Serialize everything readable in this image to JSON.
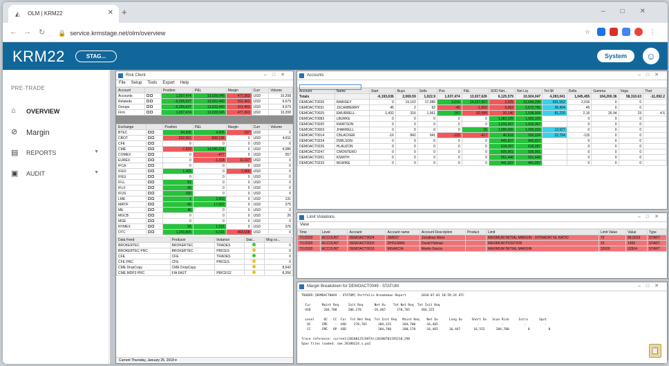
{
  "browser": {
    "tab_title": "OLM | KRM22",
    "url": "service.krmstage.net/olm/overview"
  },
  "app": {
    "logo": "KRM22",
    "env": "STAG...",
    "system_btn": "System"
  },
  "sidebar": {
    "section": "PRE-TRADE",
    "items": [
      {
        "label": "OVERVIEW",
        "icon": "home-icon"
      },
      {
        "label": "Margin",
        "icon": "margin-icon"
      },
      {
        "label": "REPORTS",
        "icon": "reports-icon"
      },
      {
        "label": "AUDIT",
        "icon": "audit-icon"
      }
    ]
  },
  "risk": {
    "title": "Risk Client",
    "menu": [
      "File",
      "Setup",
      "Tools",
      "Export",
      "Help"
    ],
    "t1_headers": [
      "Account",
      "",
      "Position",
      "P&L",
      "Margin",
      "Curr",
      "Volume"
    ],
    "t1_rows": [
      [
        "Accounts",
        "1,037,474",
        "13,028,045",
        "477,363",
        "USD",
        "10,208"
      ],
      [
        "Relateds",
        "-6,295,637",
        "13,033,449",
        "151,463",
        "USD",
        "9,679"
      ],
      [
        "Groups",
        "-6,295,637",
        "13,033,449",
        "151,463",
        "USD",
        "9,679"
      ],
      [
        "Firm",
        "1,037,474",
        "13,028,045",
        "477,363",
        "USD",
        "10,208"
      ]
    ],
    "t2_headers": [
      "Exchange",
      "",
      "Position",
      "P&L",
      "Margin",
      "Curr",
      "Volume"
    ],
    "t2_rows": [
      [
        "BTEC",
        "64,935",
        "4,505",
        "337",
        "USD",
        "0"
      ],
      [
        "CBOT",
        "-232,051",
        "-939,136",
        "0",
        "USD",
        "4,811"
      ],
      [
        "CFE",
        "0",
        "0",
        "0",
        "USD",
        "0"
      ],
      [
        "CME",
        "-7,929",
        "14,046,634",
        "0",
        "USD",
        "4,086"
      ],
      [
        "COMEX",
        "0",
        "-477",
        "0",
        "USD",
        "557"
      ],
      [
        "EUREX",
        "0",
        "-1,318",
        "11,117",
        "USD",
        "0"
      ],
      [
        "IFCA",
        "0",
        "0",
        "0",
        "USD",
        "0"
      ],
      [
        "IFEO",
        "1,405",
        "0",
        "1,466",
        "USD",
        "0"
      ],
      [
        "IFEU",
        "0",
        "0",
        "0",
        "USD",
        "0"
      ],
      [
        "IFLL",
        "81",
        "0",
        "0",
        "USD",
        "0"
      ],
      [
        "IFLX",
        "56",
        "0",
        "0",
        "USD",
        "0"
      ],
      [
        "IFUS",
        "100",
        "0",
        "0",
        "USD",
        "0"
      ],
      [
        "LME",
        "1",
        "3,960",
        "0",
        "USD",
        "131"
      ],
      [
        "MATIF",
        "66",
        "17,922",
        "0",
        "USD",
        "275"
      ],
      [
        "ME",
        "46",
        "0",
        "0",
        "USD",
        "0"
      ],
      [
        "MGCB",
        "0",
        "0",
        "0",
        "USD",
        "26"
      ],
      [
        "MGE",
        "0",
        "0",
        "0",
        "USD",
        "0"
      ],
      [
        "NYMEX",
        "56",
        "1,515",
        "0",
        "USD",
        "376"
      ],
      [
        "OTC",
        "1,243,805",
        "6,016",
        "464,508",
        "USD",
        "0"
      ]
    ],
    "t3_headers": [
      "Data Feed",
      "Producer",
      "Instance",
      "Stat...",
      "Msg co..."
    ],
    "t3_rows": [
      [
        "BROKERTEC",
        "BROKERTEC",
        "TRADES",
        "0"
      ],
      [
        "BROKERTEC PRC",
        "BROKERTEC",
        "PRICES",
        "0"
      ],
      [
        "CFE",
        "CFE",
        "TRADES",
        "0"
      ],
      [
        "CFE PRC",
        "CFE",
        "PRICES",
        "0"
      ],
      [
        "CME DropCopy",
        "CME DropCopy",
        "",
        "8,642"
      ],
      [
        "CME MDP3 PRC",
        "FIA FAST",
        "PRICES2",
        "8,356"
      ]
    ],
    "status": "Current Thursday, January 25, 2018"
  },
  "accounts": {
    "title": "Accounts",
    "headers": [
      "Account",
      "Name",
      "Start",
      "Buys",
      "Sells",
      "Pos",
      "P&L",
      "SOD Net...",
      "Net Liq",
      "Tot IM",
      "Delta",
      "Gamma",
      "Vega",
      "Thet"
    ],
    "totals": [
      "Totals",
      "",
      "-6,193,636",
      "2,069.59",
      "1,022.9",
      "1,037,474",
      "13,027,626",
      "6,125,579",
      "10,924,047",
      "4,283,041",
      "1,045,455",
      "104,200.36",
      "58,310.63",
      "-11,092.2"
    ],
    "rows": [
      [
        "DEMOACT0026",
        "RAINSEY",
        "0",
        "19,102",
        "17,086",
        "2,016",
        "14,237,067",
        "2,025",
        "12,649,200",
        "691,552",
        "2,016",
        "0",
        "0",
        ""
      ],
      [
        "DEMOACT0031",
        "JSCARBERRY",
        "45",
        "2",
        "92",
        "-45",
        "-1,652",
        "6,062",
        "2,672,765",
        "36,404",
        "45",
        "0",
        "0",
        ""
      ],
      [
        "DEMOACT0025",
        "EMURRELL",
        "1,432",
        "316",
        "1,561",
        "187",
        "-92,089",
        "20,140",
        "1,538,909",
        "81,225",
        "2,16",
        "26.94",
        "23",
        "4.5"
      ],
      [
        "DEMOACT0083",
        "LBURKE",
        "0",
        "0",
        "0",
        "0",
        "0",
        "1,083,325",
        "1,083,325",
        "",
        "0",
        "0",
        "0",
        ""
      ],
      [
        "DEMOACT0020",
        "KWATSON",
        "0",
        "0",
        "0",
        "0",
        "0",
        "1,016,367",
        "1,016,367",
        "",
        "0",
        "0",
        "0",
        ""
      ],
      [
        "DEMOACT0003",
        "JHARRELL",
        "0",
        "0",
        "0",
        "0",
        "15",
        "1,000,006",
        "1,000,015",
        "12,927",
        "0",
        "0",
        "0",
        ""
      ],
      [
        "DEMOACT0014",
        "CBLACKER",
        "-16",
        "842",
        "941",
        "-115",
        "-417",
        "40,618",
        "926,224",
        "22,764",
        "-115",
        "0",
        "0",
        ""
      ],
      [
        "DEMOACT0224",
        "DWILSON",
        "0",
        "0",
        "0",
        "0",
        "0",
        "845,837",
        "845,837",
        "",
        "0",
        "0",
        "0",
        ""
      ],
      [
        "DEMOACT0226",
        "HLAUZON",
        "0",
        "0",
        "0",
        "0",
        "0",
        "618,287",
        "618,287",
        "",
        "0",
        "0",
        "0",
        ""
      ],
      [
        "DEMOACT0247",
        "CMONTERO",
        "0",
        "0",
        "0",
        "0",
        "0",
        "505,901",
        "505,901",
        "",
        "0",
        "0",
        "0",
        ""
      ],
      [
        "DEMOACT0261",
        "KSMITH",
        "0",
        "0",
        "0",
        "0",
        "0",
        "551,446",
        "551,446",
        "",
        "0",
        "0",
        "0",
        ""
      ],
      [
        "DEMOACT0233",
        "WLWIKE",
        "0",
        "0",
        "0",
        "0",
        "0",
        "441,937",
        "441,937",
        "",
        "0",
        "0",
        "0",
        ""
      ]
    ]
  },
  "violations": {
    "title": "Limit Violations",
    "view": "View",
    "headers": [
      "Time",
      "Level",
      "Account",
      "Account name",
      "Account Description",
      "Product",
      "Limit",
      "Limit Value",
      "Value",
      "Type"
    ],
    "rows": [
      [
        "7/1/2020",
        "ACCOUNT",
        "DEMOACT0024",
        "JWEST",
        "Jonathan West",
        "",
        "MAXIMUM INITIAL MARGIN - INTRADAY NL RATIO",
        "70",
        "88.9019",
        "START"
      ],
      [
        "7/1/2020",
        "ACCOUNT",
        "DEMOACT0003",
        "DHOLMAN",
        "David Holman",
        "",
        "MAXIMUM POSITION",
        "15",
        "1400",
        "START"
      ],
      [
        "7/1/2020",
        "ACCOUNT",
        "DEMOACT0016",
        "MGARCIA",
        "Martin Garcia",
        "",
        "MAXIMUM INITIAL MARGIN",
        "32000",
        "32504",
        "START"
      ]
    ]
  },
  "breakdown": {
    "title": "Margin Breakdown for DEMOACT0049 - STATUM",
    "lines": [
      "TRADER:[DEMOACT0049 - STATUM] Portfolio Breakdown Report        2018-07-01 10:59:24 UTC",
      "",
      "  Cur      Maint Req     Init Req      Net Ov    Tot Net Req  Tot Init Req",
      "  USD       204,700      206,270      -16,465      270,765      204,225",
      "",
      "  Level     OC   CC  Cur  Tot Net Req  Tot Init Req   Maint Req    Net Ov      Long Ov     Short Ov   Scan Risk     Intra      Spot",
      "   OC      CME    -  USD    270,765      204,225      204,700     -16,465        -            -            -           -          -",
      "   CC      CME   OP  USD      -          204,700      200,578     -16,465      16,467       16,552      204,700          0          0",
      "",
      "Trace reference: current(20180125(DATA)|20180701195210_298",
      "Span files loaded: cme.20180124.s.pa2"
    ]
  }
}
